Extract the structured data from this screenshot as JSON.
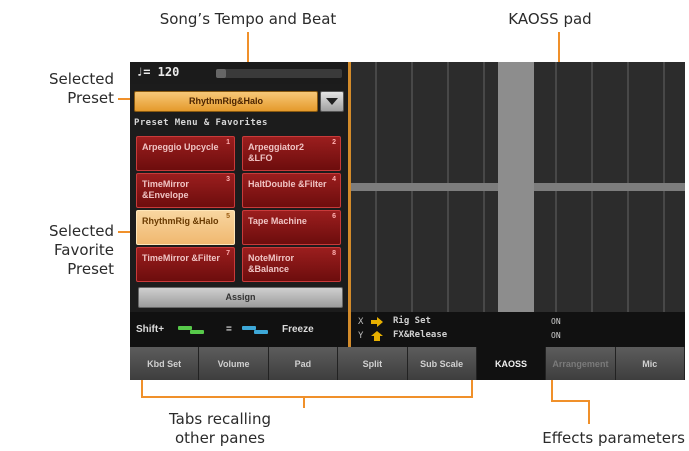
{
  "callouts": {
    "tempo": "Song’s Tempo and Beat",
    "kaoss": "KAOSS pad",
    "preset_1": "Selected",
    "preset_2": "Preset",
    "favorite_1": "Selected",
    "favorite_2": "Favorite",
    "favorite_3": "Preset",
    "tabs_1": "Tabs recalling",
    "tabs_2": "other panes",
    "effects": "Effects parameters"
  },
  "screen": {
    "tempo": "♩= 120",
    "preset_selected": "RhythmRig&Halo",
    "preset_menu_title": "Preset Menu & Favorites",
    "favorites": [
      {
        "name": "Arpeggio Upcycle",
        "num": "1"
      },
      {
        "name": "Arpeggiator2 &LFO",
        "num": "2"
      },
      {
        "name": "TimeMirror &Envelope",
        "num": "3"
      },
      {
        "name": "HaltDouble &Filter",
        "num": "4"
      },
      {
        "name": "RhythmRig &Halo",
        "num": "5"
      },
      {
        "name": "Tape Machine",
        "num": "6"
      },
      {
        "name": "TimeMirror &Filter",
        "num": "7"
      },
      {
        "name": "NoteMirror &Balance",
        "num": "8"
      }
    ],
    "assign_label": "Assign",
    "shift_label": "Shift+",
    "equals_label": "=",
    "freeze_label": "Freeze",
    "params": {
      "x_axis": "X",
      "y_axis": "Y",
      "x_name": "Rig Set",
      "y_name": "FX&Release",
      "x_value": "ON",
      "y_value": "ON"
    },
    "tabs": [
      "Kbd Set",
      "Volume",
      "Pad",
      "Split",
      "Sub Scale",
      "KAOSS",
      "Arrangement",
      "Mic"
    ],
    "accent_orange": "#f0902a",
    "favorite_red": "#8b1a1a",
    "selected_peach": "#f4c685"
  }
}
